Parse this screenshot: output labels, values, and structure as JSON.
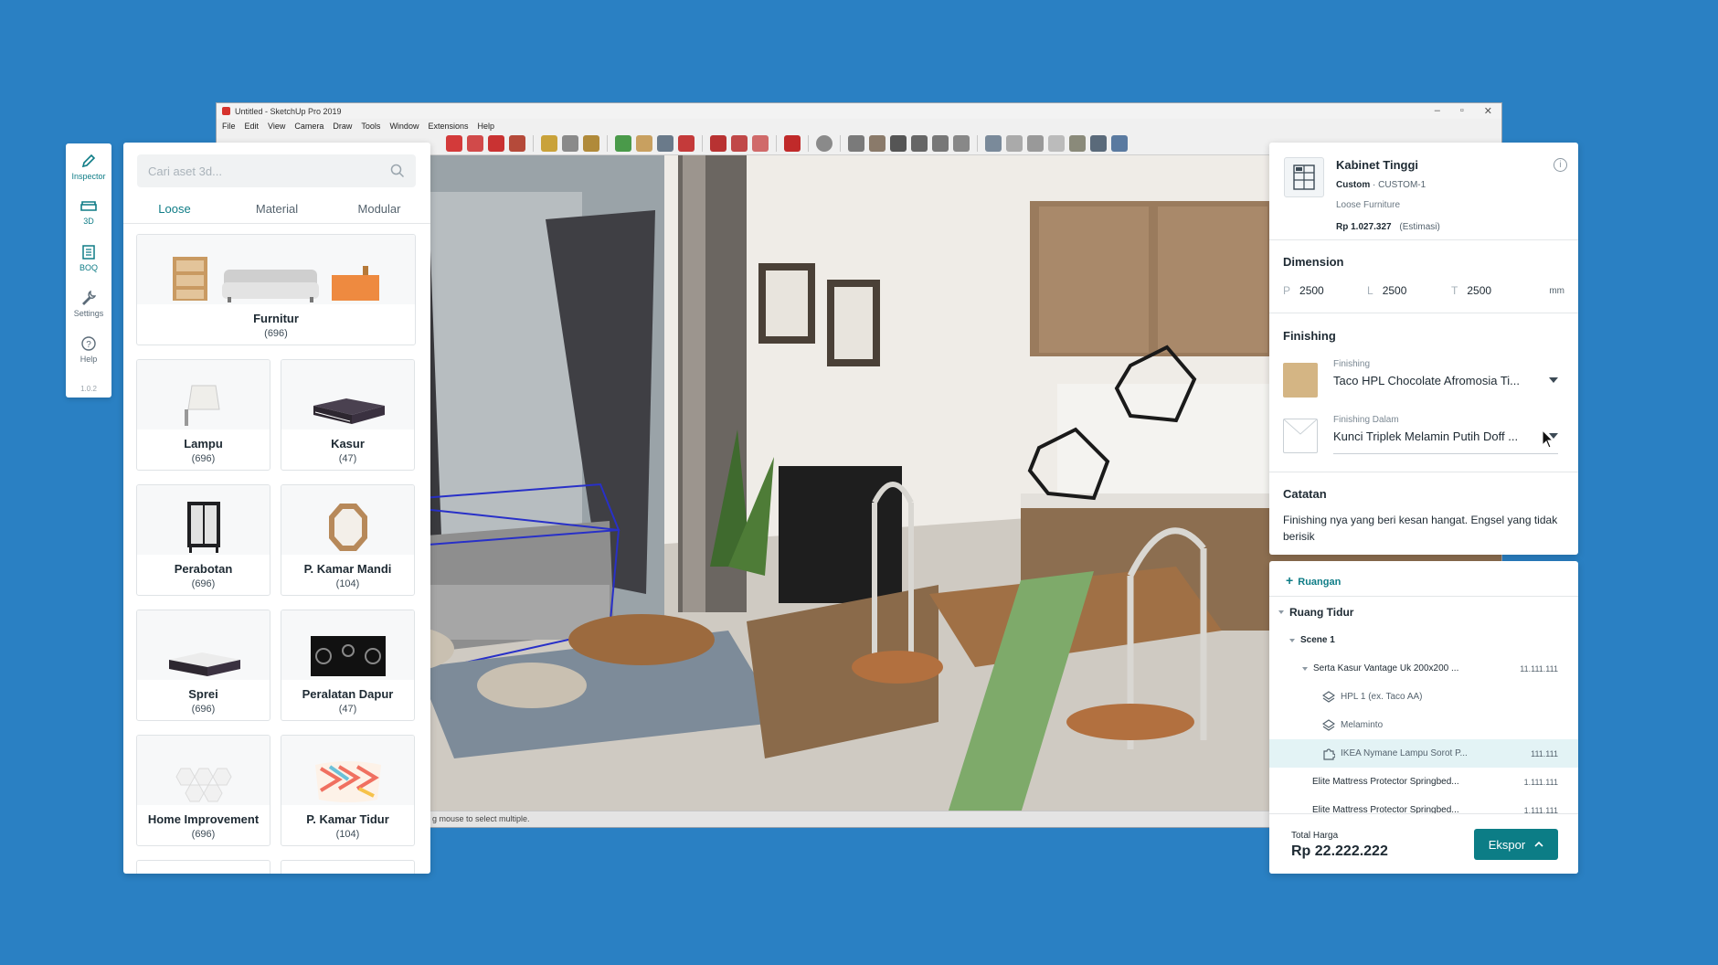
{
  "sketchup": {
    "title": "Untitled - SketchUp Pro 2019",
    "menu": [
      "File",
      "Edit",
      "View",
      "Camera",
      "Draw",
      "Tools",
      "Window",
      "Extensions",
      "Help"
    ],
    "status": "g mouse to select multiple."
  },
  "rail": {
    "items": [
      {
        "label": "Inspector",
        "icon": "pencil-icon"
      },
      {
        "label": "3D",
        "icon": "sofa-icon"
      },
      {
        "label": "BOQ",
        "icon": "list-icon"
      },
      {
        "label": "Settings",
        "icon": "wrench-icon"
      },
      {
        "label": "Help",
        "icon": "help-icon"
      }
    ],
    "version": "1.0.2"
  },
  "assets": {
    "search_placeholder": "Cari aset 3d...",
    "tabs": [
      "Loose",
      "Material",
      "Modular"
    ],
    "active_tab": "Loose",
    "featured": {
      "name": "Furnitur",
      "count": "(696)"
    },
    "cards": [
      {
        "name": "Lampu",
        "count": "(696)",
        "icon": "lamp-icon"
      },
      {
        "name": "Kasur",
        "count": "(47)",
        "icon": "mattress-icon"
      },
      {
        "name": "Perabotan",
        "count": "(696)",
        "icon": "cabinet-icon"
      },
      {
        "name": "P. Kamar Mandi",
        "count": "(104)",
        "icon": "mirror-icon"
      },
      {
        "name": "Sprei",
        "count": "(696)",
        "icon": "bedsheet-icon"
      },
      {
        "name": "Peralatan Dapur",
        "count": "(47)",
        "icon": "stove-icon"
      },
      {
        "name": "Home Improvement",
        "count": "(696)",
        "icon": "tile-icon"
      },
      {
        "name": "P. Kamar Tidur",
        "count": "(104)",
        "icon": "pillow-icon"
      }
    ]
  },
  "inspector": {
    "title": "Kabinet Tinggi",
    "custom_label": "Custom",
    "code": "CUSTOM-1",
    "category": "Loose Furniture",
    "price": "Rp 1.027.327",
    "price_note": "(Estimasi)",
    "dimension": {
      "title": "Dimension",
      "p_label": "P",
      "p": "2500",
      "l_label": "L",
      "l": "2500",
      "t_label": "T",
      "t": "2500",
      "unit": "mm"
    },
    "finishing": {
      "title": "Finishing",
      "outer_label": "Finishing",
      "outer_value": "Taco HPL Chocolate Afromosia Ti...",
      "outer_color": "#d4b584",
      "inner_label": "Finishing Dalam",
      "inner_value": "Kunci Triplek Melamin Putih Doff ...",
      "inner_color": "#ffffff"
    },
    "notes": {
      "title": "Catatan",
      "text": "Finishing nya yang beri kesan hangat. Engsel yang tidak berisik"
    }
  },
  "boq": {
    "add_room": "Ruangan",
    "room": "Ruang Tidur",
    "scene": "Scene 1",
    "items": [
      {
        "name": "Serta Kasur Vantage Uk 200x200 ...",
        "price": "11.111.111",
        "level": 3
      },
      {
        "name": "HPL 1 (ex. Taco AA)",
        "price": "",
        "level": 4,
        "icon": "layers-icon"
      },
      {
        "name": "Melaminto",
        "price": "",
        "level": 4,
        "icon": "layers-icon"
      },
      {
        "name": "IKEA Nymane Lampu Sorot P...",
        "price": "111.111",
        "level": 4,
        "icon": "puzzle-icon",
        "highlight": true
      },
      {
        "name": "Elite Mattress Protector Springbed...",
        "price": "1.111.111",
        "level": 3
      },
      {
        "name": "Elite Mattress Protector Springbed...",
        "price": "1.111.111",
        "level": 3
      }
    ],
    "total_label": "Total Harga",
    "total_value": "Rp 22.222.222",
    "export_label": "Ekspor"
  },
  "colors": {
    "background": "#2a80c3",
    "accent": "#0c7d86"
  }
}
